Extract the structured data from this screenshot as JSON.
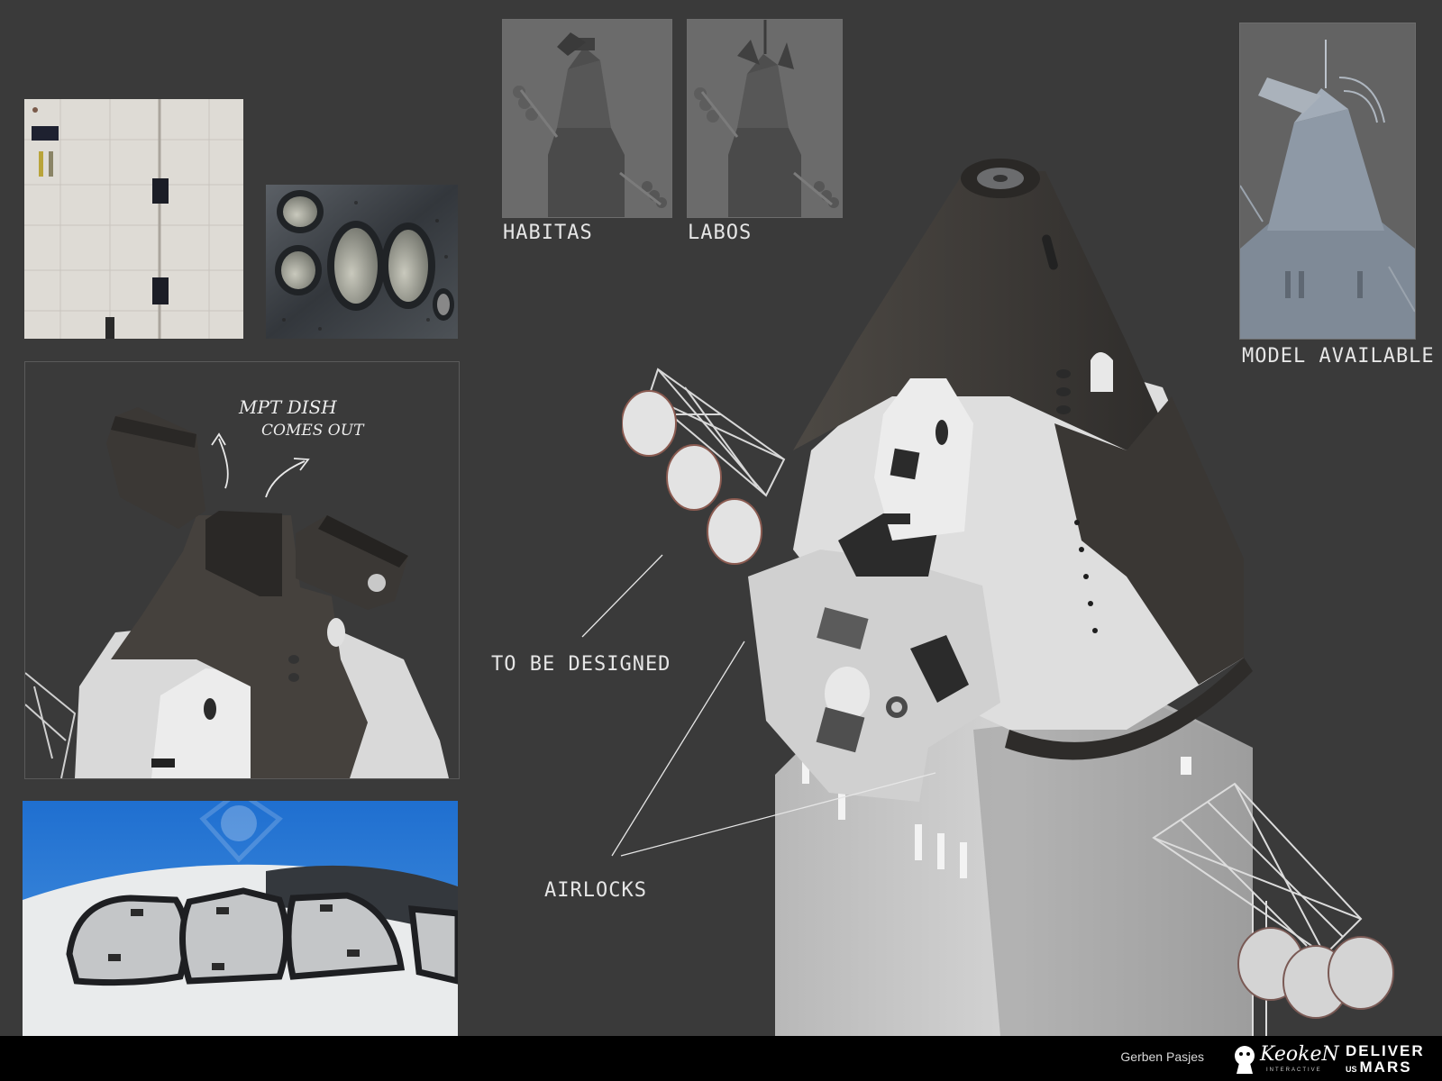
{
  "labels": {
    "habitas": "HABITAS",
    "labos": "LABOS",
    "model_available": "MODEL AVAILABLE",
    "to_be_designed": "TO BE DESIGNED",
    "airlocks": "AIRLOCKS"
  },
  "annotation": {
    "line1": "MPT DISH",
    "line2": "COMES OUT"
  },
  "footer": {
    "author": "Gerben Pasjes",
    "studio": "KeokeN",
    "studio_sub": "INTERACTIVE",
    "game_line1": "DELIVER",
    "game_us": "US",
    "game_line2": "MARS"
  },
  "colors": {
    "background": "#3a3a3a",
    "footer": "#000000",
    "hull_white": "#e4e4e4",
    "hull_dark": "#3d3a37",
    "sky_blue": "#2f7fd6"
  }
}
